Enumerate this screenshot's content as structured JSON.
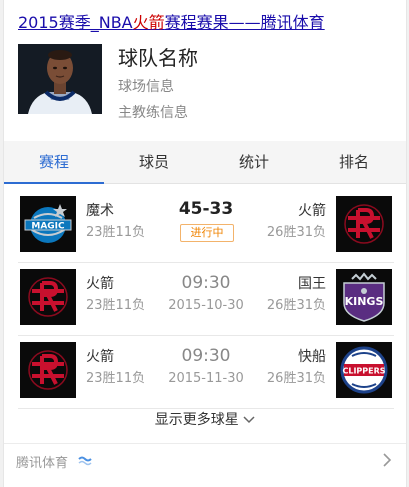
{
  "header": {
    "title_part1": "2015赛季_NBA",
    "title_highlight": "火箭",
    "title_part2": "赛程赛果——腾讯体育"
  },
  "team": {
    "name": "球队名称",
    "info_venue": "球场信息",
    "info_coach": "主教练信息"
  },
  "tabs": [
    {
      "label": "赛程",
      "active": true
    },
    {
      "label": "球员"
    },
    {
      "label": "统计"
    },
    {
      "label": "排名"
    }
  ],
  "games": [
    {
      "home": {
        "name": "魔术",
        "record": "23胜11负",
        "logo": "magic-logo"
      },
      "score": "45-33",
      "status": "进行中",
      "away": {
        "name": "火箭",
        "record": "26胜31负",
        "logo": "rockets-logo"
      }
    },
    {
      "home": {
        "name": "火箭",
        "record": "23胜11负",
        "logo": "rockets-logo"
      },
      "time": "09:30",
      "date": "2015-10-30",
      "away": {
        "name": "国王",
        "record": "26胜31负",
        "logo": "kings-logo"
      }
    },
    {
      "home": {
        "name": "火箭",
        "record": "23胜11负",
        "logo": "rockets-logo"
      },
      "time": "09:30",
      "date": "2015-11-30",
      "away": {
        "name": "快船",
        "record": "26胜31负",
        "logo": "clippers-logo"
      }
    }
  ],
  "more_label": "显示更多球星",
  "footer": {
    "source": "腾讯体育"
  },
  "colors": {
    "accent": "#2d6cd2",
    "live": "#f08300",
    "title_link": "#1a0dab",
    "highlight": "#cc0000"
  }
}
